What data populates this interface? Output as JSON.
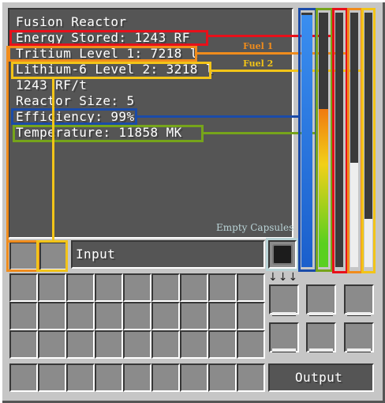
{
  "window": {
    "title": "Fusion Reactor"
  },
  "stats": {
    "energy": "Energy Stored: 1243 RF",
    "tritium": "Tritium Level 1: 7218 l",
    "lithium": "Lithium-6 Level 2: 3218 l",
    "rate": "1243 RF/t",
    "size": "Reactor Size: 5",
    "efficiency": "Efficiency: 99%",
    "temperature": "Temperature: 11858 MK"
  },
  "annotations": {
    "fuel1": "Fuel 1",
    "fuel2": "Fuel 2",
    "empty_capsules": "Empty Capsules"
  },
  "labels": {
    "input": "Input",
    "output": "Output"
  },
  "gauges": {
    "efficiency_fill": 0.99,
    "temperature_fill": 0.62,
    "energy_fill": 0.0,
    "fuel1_fill": 0.41,
    "fuel2_fill": 0.19
  },
  "colors": {
    "energy": "#e8101a",
    "fuel1": "#f08c1c",
    "fuel2": "#f2c418",
    "efficiency": "#1b4ba8",
    "temperature": "#76a41a",
    "capsules": "#b9d3d6"
  }
}
